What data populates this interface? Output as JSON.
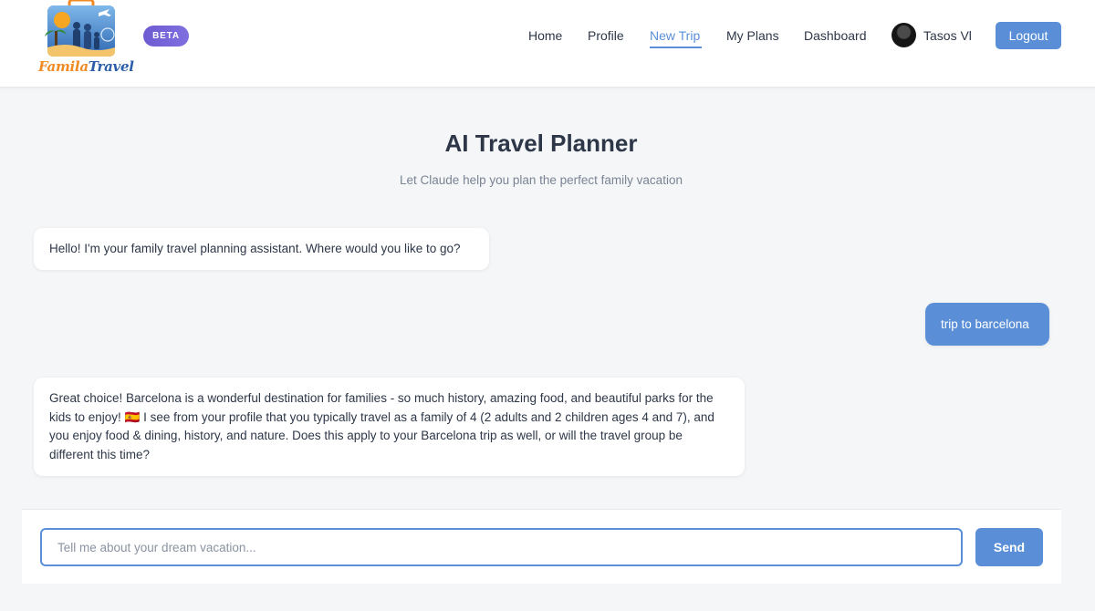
{
  "header": {
    "logo": {
      "line1": "Famila",
      "line2": "Travel"
    },
    "beta_badge": "BETA",
    "nav": [
      {
        "label": "Home",
        "active": false
      },
      {
        "label": "Profile",
        "active": false
      },
      {
        "label": "New Trip",
        "active": true
      },
      {
        "label": "My Plans",
        "active": false
      },
      {
        "label": "Dashboard",
        "active": false
      }
    ],
    "user_name": "Tasos Vl",
    "logout_label": "Logout"
  },
  "main": {
    "title": "AI Travel Planner",
    "subtitle": "Let Claude help you plan the perfect family vacation"
  },
  "chat": {
    "messages": [
      {
        "role": "assistant",
        "text": "Hello! I'm your family travel planning assistant. Where would you like to go?"
      },
      {
        "role": "user",
        "text": "trip to barcelona"
      },
      {
        "role": "assistant",
        "text": "Great choice! Barcelona is a wonderful destination for families - so much history, amazing food, and beautiful parks for the kids to enjoy! 🇪🇸 I see from your profile that you typically travel as a family of 4 (2 adults and 2 children ages 4 and 7), and you enjoy food & dining, history, and nature. Does this apply to your Barcelona trip as well, or will the travel group be different this time?"
      }
    ],
    "input_placeholder": "Tell me about your dream vacation...",
    "input_value": "",
    "send_label": "Send"
  },
  "colors": {
    "accent": "#5a8fd8",
    "beta_badge": "#6e5bd1",
    "background": "#f5f6f8",
    "text": "#2d3748"
  },
  "icons": [
    "logo-icon",
    "avatar"
  ]
}
